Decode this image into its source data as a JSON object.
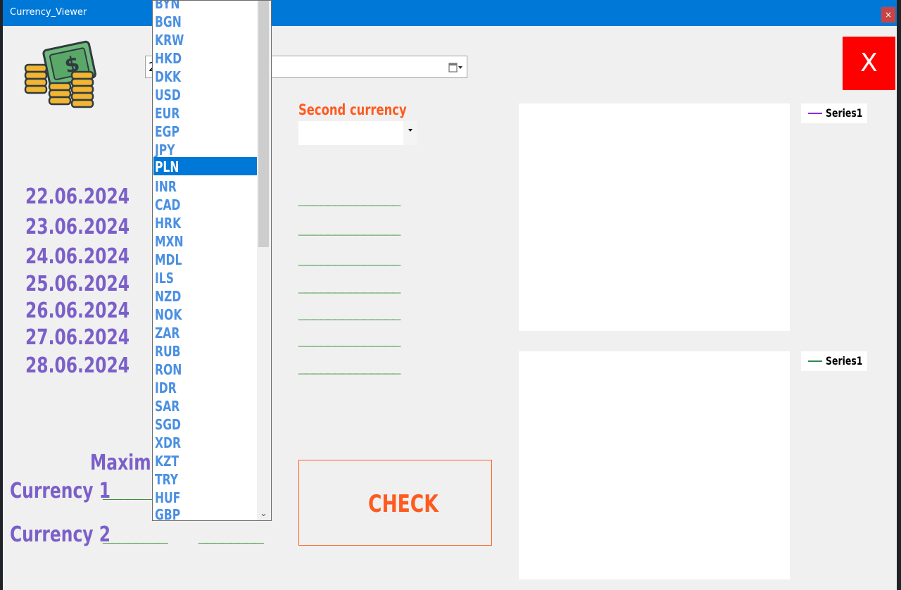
{
  "window": {
    "title": "Currency_Viewer",
    "close_label": "×"
  },
  "date_picker": {
    "value": "2"
  },
  "exit_button": {
    "label": "X"
  },
  "second_currency": {
    "label": "Second currency",
    "value": ""
  },
  "dates": [
    "22.06.2024",
    "23.06.2024",
    "24.06.2024",
    "25.06.2024",
    "26.06.2024",
    "27.06.2024",
    "28.06.2024"
  ],
  "rate_placeholders": [
    "______________",
    "______________",
    "______________",
    "______________",
    "______________",
    "______________",
    "______________"
  ],
  "charts": [
    {
      "legend": "Series1",
      "color": "#8a2be2"
    },
    {
      "legend": "Series1",
      "color": "#2e8b57"
    }
  ],
  "check_button": {
    "label": "CHECK"
  },
  "summary": {
    "max_label": "Maximu",
    "currency1_label": "Currency 1",
    "currency1_value": "________",
    "currency2_label": "Currency 2",
    "currency2_value_a": "________",
    "currency2_value_b": "________"
  },
  "dropdown": {
    "items": [
      "BYN",
      "BGN",
      "KRW",
      "HKD",
      "DKK",
      "USD",
      "EUR",
      "EGP",
      "JPY",
      "PLN",
      "INR",
      "CAD",
      "HRK",
      "MXN",
      "MDL",
      "ILS",
      "NZD",
      "NOK",
      "ZAR",
      "RUB",
      "RON",
      "IDR",
      "SAR",
      "SGD",
      "XDR",
      "KZT",
      "TRY",
      "HUF",
      "GBP"
    ],
    "selected": "PLN"
  },
  "colors": {
    "accent_orange": "#ff5a1f",
    "date_purple": "#7b5fc9",
    "green": "#2e8b2e",
    "title_blue": "#0078d7"
  }
}
